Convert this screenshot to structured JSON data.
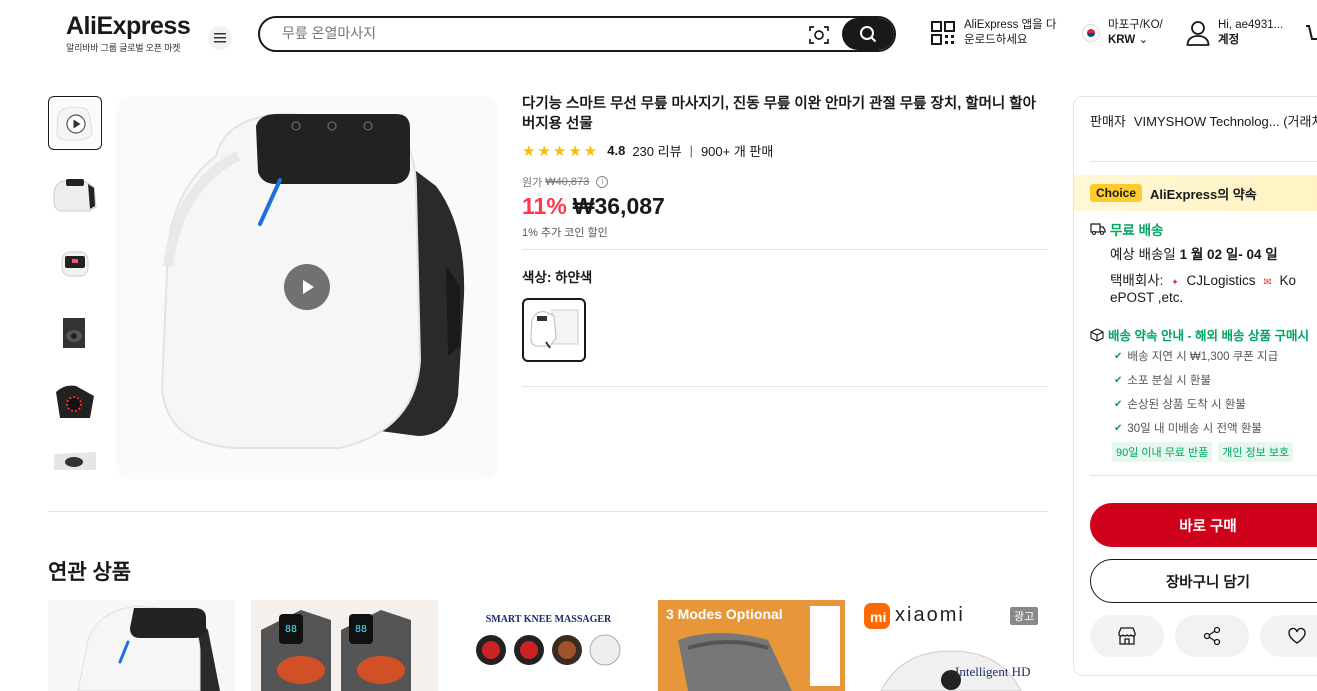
{
  "header": {
    "logo": "AliExpress",
    "logo_sub": "알리바바 그룹 글로벌 오픈 마켓",
    "search_placeholder": "무릎 온열마사지",
    "app_download": "AliExpress 앱을 다운로드하세요",
    "region": "마포구/KO/",
    "currency": "KRW",
    "greeting": "Hi, ae4931...",
    "account": "계정"
  },
  "product": {
    "title": "다기능 스마트 무선 무릎 마사지기, 진동 무릎 이완 안마기 관절 무릎 장치, 할머니 할아버지용 선물",
    "stars": "★★★★★",
    "rating": "4.8",
    "reviews": "230 리뷰",
    "sold": "900+ 개 판매",
    "orig_label": "원가",
    "orig_price": "₩40,873",
    "discount": "11%",
    "price": "₩36,087",
    "coin": "1% 추가 코인 할인",
    "color_label": "색상: 하얀색"
  },
  "related": {
    "title": "연관 상품",
    "card3_text": "SMART KNEE MASSAGER",
    "card4_text": "3 Modes Optional",
    "card5_brand": "xiaomi",
    "card5_ad": "광고",
    "card5_sub": "Intelligent HD"
  },
  "side": {
    "seller_label": "판매자",
    "seller_name": "VIMYSHOW Technolog... (거래처)",
    "choice_badge": "Choice",
    "choice_text": "AliExpress의 약속",
    "free_ship": "무료 배송",
    "eta_label": "예상 배송일",
    "eta_value": "1 월 02 일- 04 일",
    "carrier_label": "택배회사:",
    "carrier_value": "CJLogistics",
    "carrier_more": "Ko",
    "carrier_line2": "ePOST ,etc.",
    "promise_head": "배송 약속 안내 - 해외 배송 상품 구매시",
    "promise_items": [
      "배송 지연 시 ₩1,300 쿠폰 지급",
      "소포 분실 시 환불",
      "손상된 상품 도착 시 환불",
      "30일 내 미배송 시 전액 환불"
    ],
    "tag1": "90일 이내 무료 반품",
    "tag2": "개인 정보 보호",
    "buy_now": "바로 구매",
    "add_cart": "장바구니 담기"
  },
  "colors": {
    "brand_red": "#d0021b",
    "discount_red": "#fd384f",
    "green": "#00a55f",
    "choice_yellow": "#fecb2f",
    "star": "#fdb913"
  }
}
